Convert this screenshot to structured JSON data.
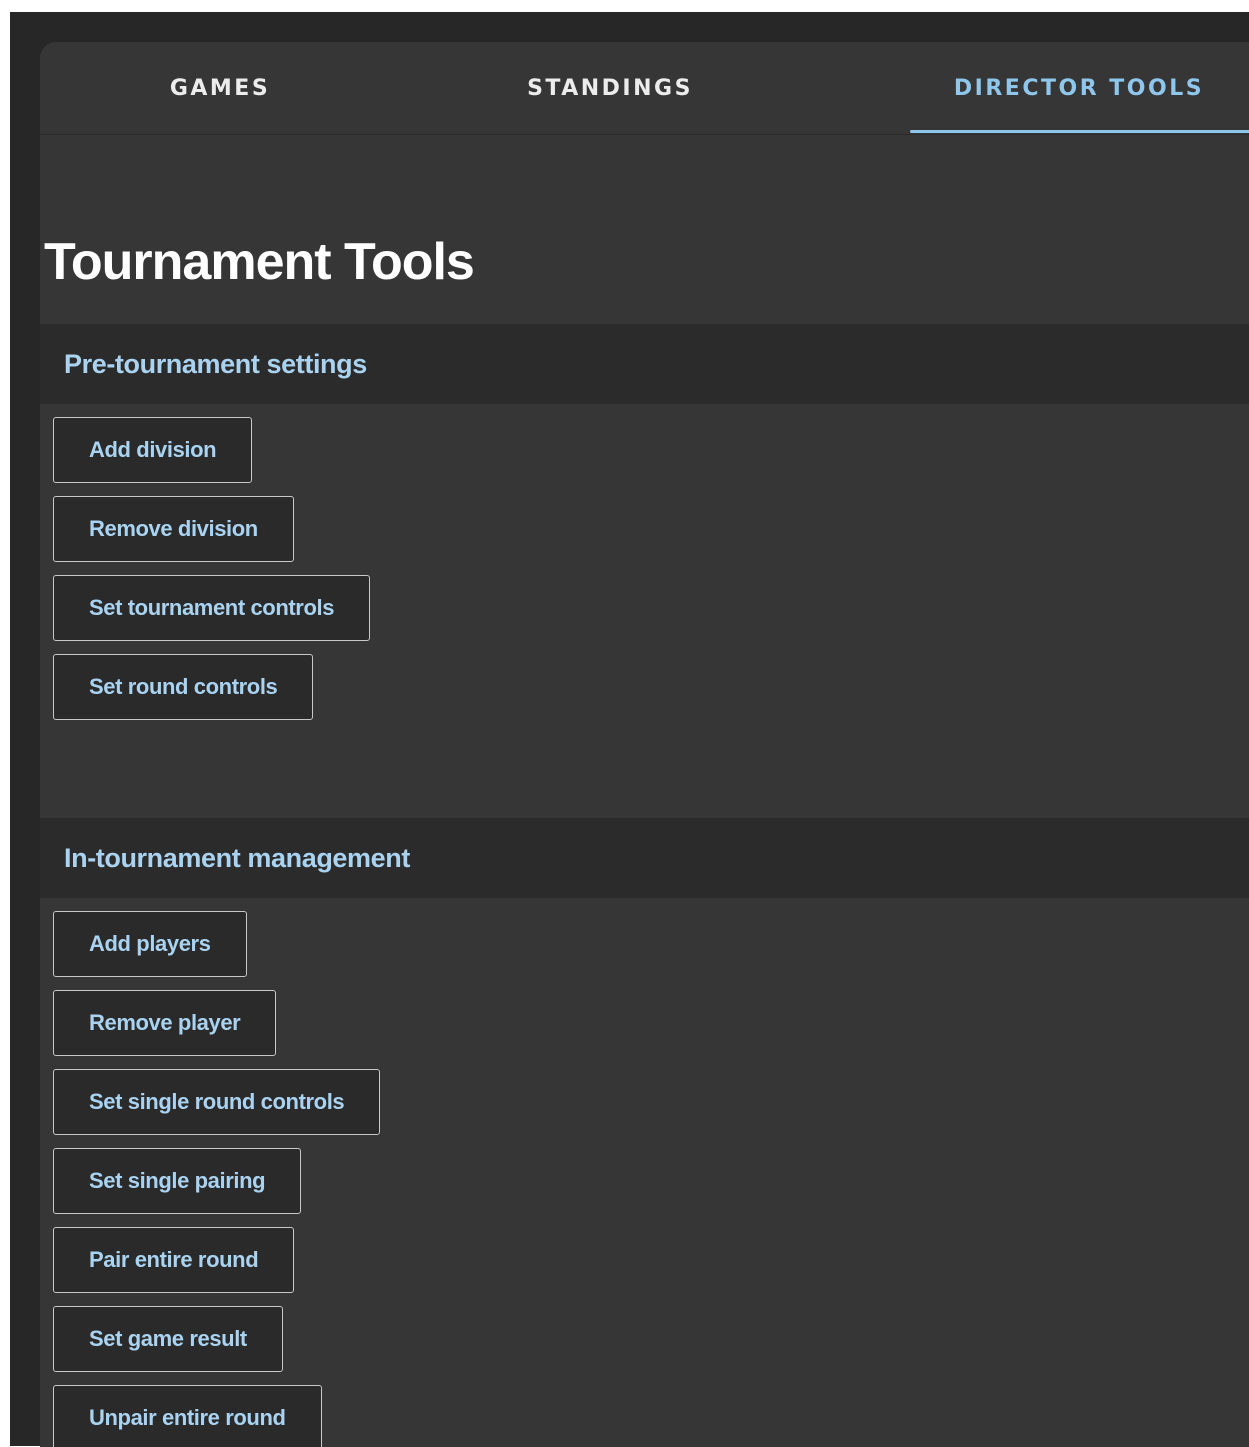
{
  "tabs": [
    {
      "label": "GAMES",
      "active": false
    },
    {
      "label": "STANDINGS",
      "active": false
    },
    {
      "label": "DIRECTOR TOOLS",
      "active": true
    }
  ],
  "page_title": "Tournament Tools",
  "sections": {
    "pre": {
      "title": "Pre-tournament settings",
      "buttons": [
        "Add division",
        "Remove division",
        "Set tournament controls",
        "Set round controls"
      ]
    },
    "in": {
      "title": "In-tournament management",
      "buttons": [
        "Add players",
        "Remove player",
        "Set single round controls",
        "Set single pairing",
        "Pair entire round",
        "Set game result",
        "Unpair entire round"
      ]
    }
  },
  "colors": {
    "accent": "#8fc6ec",
    "background": "#363636",
    "section_header_bg": "#2b2b2b",
    "button_border": "#c8c8c8"
  }
}
